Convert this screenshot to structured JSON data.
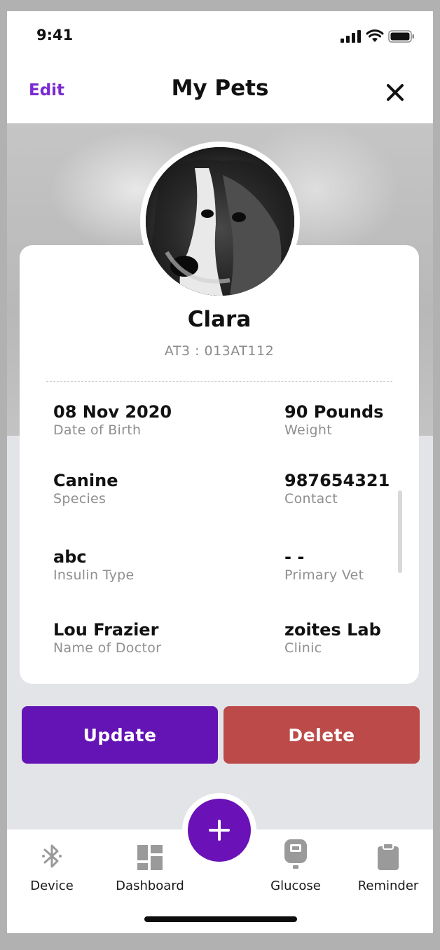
{
  "status_bar": {
    "time": "9:41"
  },
  "navbar": {
    "edit_label": "Edit",
    "title": "My Pets"
  },
  "pet": {
    "name": "Clara",
    "id_line": "AT3 : 013AT112"
  },
  "fields": [
    {
      "value": "08 Nov 2020",
      "label": "Date of Birth"
    },
    {
      "value": "90 Pounds",
      "label": "Weight"
    },
    {
      "value": "Canine",
      "label": "Species"
    },
    {
      "value": "987654321",
      "label": "Contact"
    },
    {
      "value": "abc",
      "label": "Insulin Type"
    },
    {
      "value": "- -",
      "label": "Primary Vet"
    },
    {
      "value": "Lou Frazier",
      "label": "Name of Doctor"
    },
    {
      "value": "zoites Lab",
      "label": "Clinic"
    }
  ],
  "actions": {
    "update_label": "Update",
    "delete_label": "Delete"
  },
  "tabs": [
    {
      "label": "Device",
      "icon": "bluetooth-icon"
    },
    {
      "label": "Dashboard",
      "icon": "dashboard-icon"
    },
    {
      "label": "Glucose",
      "icon": "glucose-meter-icon"
    },
    {
      "label": "Reminder",
      "icon": "clipboard-icon"
    }
  ],
  "colors": {
    "accent": "#7b2ad2",
    "update": "#6414b5",
    "delete": "#bb4a48",
    "fab": "#6a12b8"
  }
}
